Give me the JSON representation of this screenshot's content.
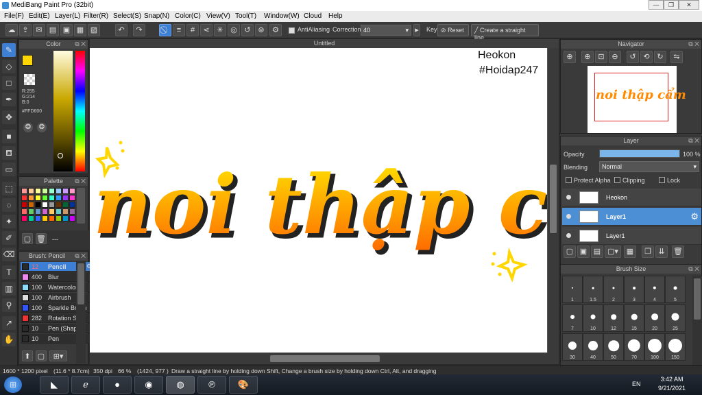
{
  "window": {
    "title": "MediBang Paint Pro (32bit)"
  },
  "menu": [
    "File(F)",
    "Edit(E)",
    "Layer(L)",
    "Filter(R)",
    "Select(S)",
    "Snap(N)",
    "Color(C)",
    "View(V)",
    "Tool(T)",
    "Window(W)",
    "Cloud",
    "Help"
  ],
  "toolbar": {
    "antialiasing": "AntiAliasing",
    "correction_label": "Correction",
    "correction_value": "40",
    "key_label": "Key",
    "reset_label": "Reset",
    "straight_line_label": "Create a straight line"
  },
  "color_panel": {
    "title": "Color",
    "r": "R:255",
    "g": "G:214",
    "b": "B:0",
    "hex": "#FFD600",
    "primary": "#FFD600",
    "secondary": "#FF8A00"
  },
  "palette_panel": {
    "title": "Palette",
    "footer": "---"
  },
  "brush_panel": {
    "title": "Brush: Pencil",
    "items": [
      {
        "size": "12",
        "name": "Pencil",
        "color": "#2a2a2a"
      },
      {
        "size": "400",
        "name": "Blur",
        "color": "#ee88ee"
      },
      {
        "size": "100",
        "name": "Watercolor",
        "color": "#88ddff"
      },
      {
        "size": "100",
        "name": "Airbrush",
        "color": "#dddddd"
      },
      {
        "size": "100",
        "name": "Sparkle Brush",
        "color": "#3355ff"
      },
      {
        "size": "282",
        "name": "Rotation S",
        "color": "#ee3333"
      },
      {
        "size": "10",
        "name": "Pen (Shape)",
        "color": "#2a2a2a"
      },
      {
        "size": "10",
        "name": "Pen",
        "color": "#2a2a2a"
      }
    ]
  },
  "canvas": {
    "tab_title": "Untitled",
    "watermark_1": "Heokon",
    "watermark_2": "#Hoidap247",
    "art_text": "noi thập cẩm"
  },
  "navigator": {
    "title": "Navigator"
  },
  "layer_panel": {
    "title": "Layer",
    "opacity_label": "Opacity",
    "opacity_value": "100 %",
    "opacity": 1.0,
    "blending_label": "Blending",
    "blending_value": "Normal",
    "protect_alpha": "Protect Alpha",
    "clipping": "Clipping",
    "lock": "Lock",
    "layers": [
      {
        "name": "Heokon",
        "selected": false
      },
      {
        "name": "Layer1",
        "selected": true
      },
      {
        "name": "Layer1",
        "selected": false
      }
    ]
  },
  "brush_size_panel": {
    "title": "Brush Size",
    "sizes": [
      "1",
      "1.5",
      "2",
      "3",
      "4",
      "5",
      "7",
      "10",
      "12",
      "15",
      "20",
      "25",
      "30",
      "40",
      "50",
      "70",
      "100",
      "150"
    ]
  },
  "status": {
    "dims": "1600 * 1200 pixel",
    "cm": "(11.6 * 8.7cm)",
    "dpi": "350 dpi",
    "zoom": "66 %",
    "coords": "(1424, 977 )",
    "hint": "Draw a straight line by holding down Shift, Change a brush size by holding down Ctrl, Alt, and dragging"
  },
  "taskbar": {
    "lang": "EN",
    "time": "3:42 AM",
    "date": "9/21/2021"
  }
}
